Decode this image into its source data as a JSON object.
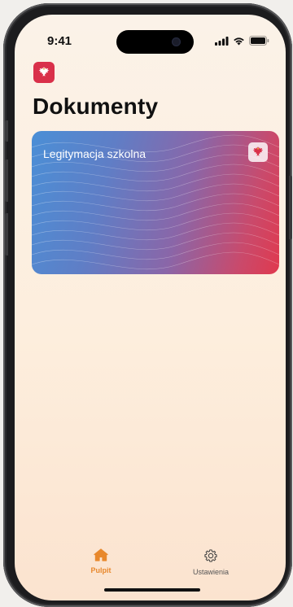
{
  "status_bar": {
    "time": "9:41"
  },
  "header": {
    "title": "Dokumenty",
    "logo_icon": "eagle-emblem-icon"
  },
  "documents": [
    {
      "title": "Legitymacja szkolna",
      "emblem_icon": "eagle-emblem-icon"
    }
  ],
  "tab_bar": {
    "tabs": [
      {
        "label": "Pulpit",
        "icon": "home-icon",
        "active": true
      },
      {
        "label": "Ustawienia",
        "icon": "gear-icon",
        "active": false
      }
    ]
  },
  "colors": {
    "accent": "#e8882c",
    "brand": "#d9304a"
  }
}
